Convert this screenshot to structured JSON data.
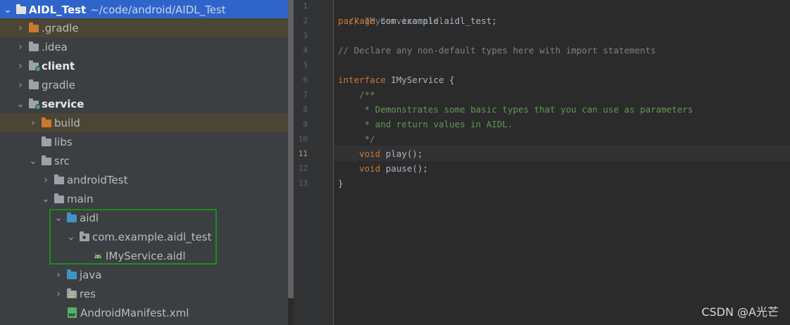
{
  "project_tree": {
    "root": {
      "name": "AIDL_Test",
      "path": "~/code/android/AIDL_Test"
    },
    "nodes": {
      "gradle_hidden": ".gradle",
      "idea": ".idea",
      "client": "client",
      "gradle": "gradle",
      "service": "service",
      "build": "build",
      "libs": "libs",
      "src": "src",
      "androidTest": "androidTest",
      "main": "main",
      "aidl": "aidl",
      "package": "com.example.aidl_test",
      "aidl_file": "IMyService.aidl",
      "java": "java",
      "res": "res",
      "manifest": "AndroidManifest.xml"
    },
    "manifest_icon_text": "MF"
  },
  "editor": {
    "line_numbers": [
      "1",
      "2",
      "3",
      "4",
      "5",
      "6",
      "7",
      "8",
      "9",
      "10",
      "11",
      "12",
      "13"
    ],
    "current_line": "11",
    "code": {
      "l1": "// IMyService.aidl",
      "l2_kw": "package",
      "l2_rest": " com.example.aidl_test;",
      "l4": "// Declare any non-default types here with import statements",
      "l6_kw": "interface",
      "l6_rest": " IMyService {",
      "l7": "    /**",
      "l8": "     * Demonstrates some basic types that you can use as parameters",
      "l9": "     * and return values in AIDL.",
      "l10": "     */",
      "l11_indent": "    ",
      "l11_kw": "void",
      "l11_rest": " play();",
      "l12_indent": "    ",
      "l12_kw": "void",
      "l12_rest": " pause();",
      "l13": "}"
    }
  },
  "watermark": "CSDN @A光芒",
  "colors": {
    "selection": "#2f65ca",
    "keyword": "#cc7832",
    "comment": "#808080",
    "doc_comment": "#629755",
    "highlight_box": "#1f8a1f"
  }
}
